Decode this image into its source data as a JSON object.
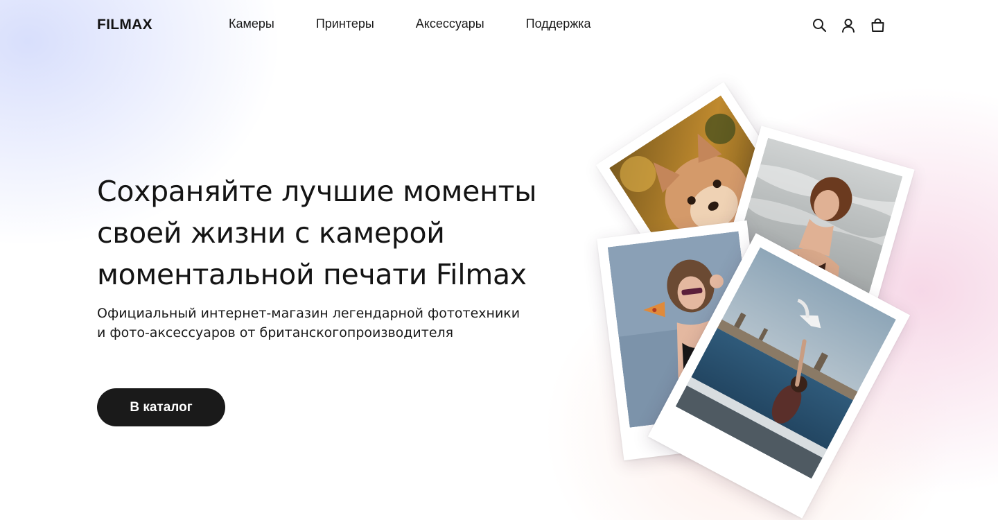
{
  "header": {
    "logo": "FILMAX",
    "nav": [
      {
        "label": "Камеры"
      },
      {
        "label": "Принтеры"
      },
      {
        "label": "Аксессуары"
      },
      {
        "label": "Поддержка"
      }
    ],
    "icons": [
      "search-icon",
      "user-icon",
      "bag-icon"
    ]
  },
  "hero": {
    "title": "Сохраняйте лучшие моменты своей жизни с камерой моментальной печати Filmax",
    "subtitle_line1": "Официальный интернет-магазин легендарной фототехники",
    "subtitle_line2": "и фото-аксессуаров от британскогопроизводителя",
    "cta_label": "В каталог"
  },
  "colors": {
    "text": "#1a1a1a",
    "button_bg": "#1a1a1a",
    "button_text": "#ffffff",
    "glow_blue": "#d6ddfc",
    "glow_pink": "#f6d6e6"
  }
}
